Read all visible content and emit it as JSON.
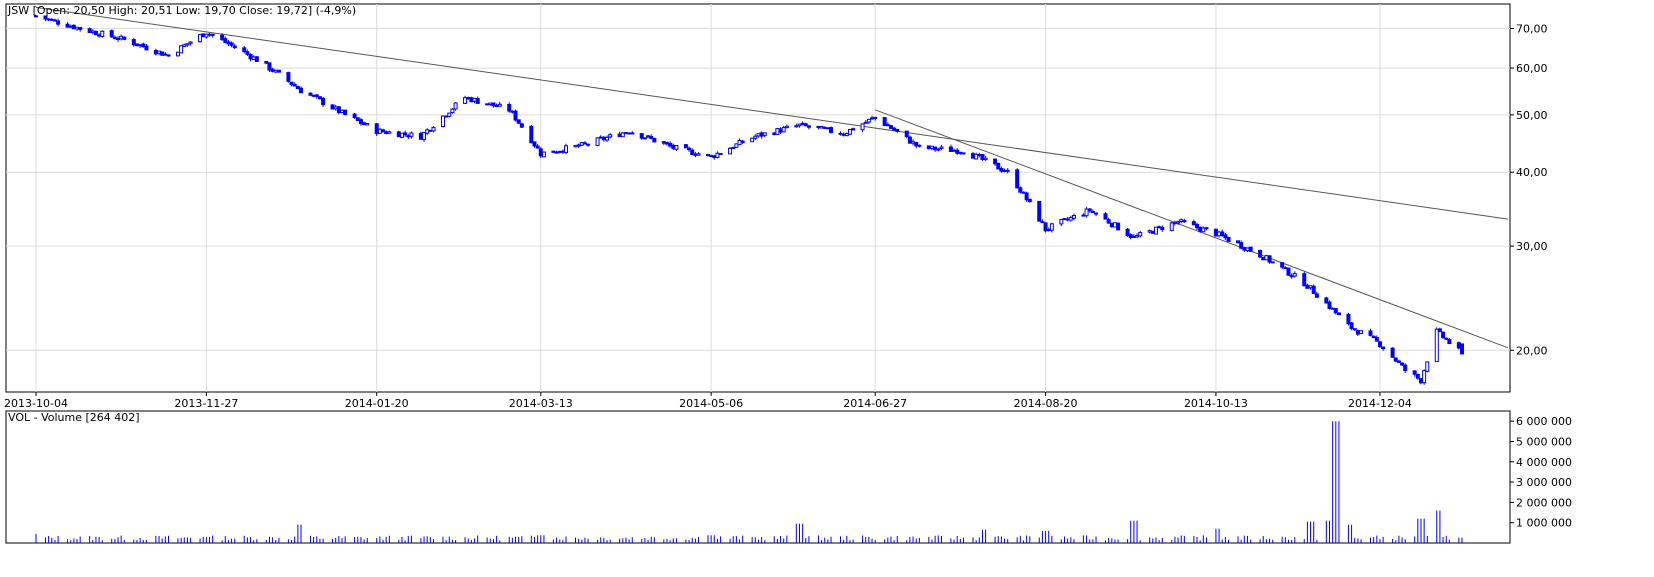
{
  "price_panel": {
    "header": "JSW [Open: 20,50  High: 20,51  Low: 19,70  Close: 19,72] (-4,9%)"
  },
  "volume_panel": {
    "header": "VOL - Volume [264 402]"
  },
  "colors": {
    "candle": "#0000ff",
    "trendline": "#555555",
    "grid": "#dcdcdc",
    "axis": "#000000",
    "background": "#ffffff"
  },
  "chart_data": [
    {
      "type": "candlestick",
      "symbol": "JSW",
      "y_scale": "log",
      "ylim": [
        17,
        77
      ],
      "yticks": [
        20,
        30,
        40,
        50,
        60,
        70
      ],
      "ytick_labels": [
        "20,00",
        "30,00",
        "40,00",
        "50,00",
        "60,00",
        "70,00"
      ],
      "x_tick_labels": [
        "2013-10-04",
        "2013-11-27",
        "2014-01-20",
        "2014-03-13",
        "2014-05-06",
        "2014-06-27",
        "2014-08-20",
        "2014-10-13",
        "2014-12-04"
      ],
      "grid": true,
      "last_bar": {
        "open": 20.5,
        "high": 20.51,
        "low": 19.7,
        "close": 19.72,
        "change_pct": -4.9
      },
      "series": [
        {
          "x": [
            "2013-10-04",
            "2013-10-18",
            "2013-11-01",
            "2013-11-15",
            "2013-11-27",
            "2013-12-13",
            "2013-12-27",
            "2014-01-10",
            "2014-01-20",
            "2014-02-03",
            "2014-02-17",
            "2014-03-03",
            "2014-03-13",
            "2014-03-27",
            "2014-04-10",
            "2014-04-24",
            "2014-05-06",
            "2014-05-20",
            "2014-06-03",
            "2014-06-17",
            "2014-06-27",
            "2014-07-11",
            "2014-07-25",
            "2014-08-08",
            "2014-08-20",
            "2014-09-03",
            "2014-09-17",
            "2014-10-01",
            "2014-10-13",
            "2014-10-27",
            "2014-11-10",
            "2014-11-24",
            "2014-12-04",
            "2014-12-12",
            "2014-12-17",
            "2014-12-22",
            "2014-12-30"
          ],
          "close": [
            73.5,
            70,
            67,
            63,
            69,
            62,
            55,
            50,
            47,
            46,
            53.5,
            51,
            43,
            44.5,
            47,
            44,
            42.5,
            46,
            48,
            46.5,
            49.5,
            44,
            43.5,
            40,
            32,
            34.5,
            31,
            33,
            31.5,
            29,
            26,
            22,
            20.5,
            18.5,
            17.8,
            21.5,
            19.72
          ]
        }
      ],
      "trendlines": [
        {
          "from": {
            "x": "2013-10-04",
            "y": 76
          },
          "to": {
            "x": "2014-12-30",
            "y": 34.2
          }
        },
        {
          "from": {
            "x": "2014-06-27",
            "y": 51
          },
          "to": {
            "x": "2014-12-30",
            "y": 21.6
          }
        }
      ]
    },
    {
      "type": "bar",
      "title": "VOL - Volume [264 402]",
      "ylim": [
        0,
        6500000
      ],
      "yticks": [
        1000000,
        2000000,
        3000000,
        4000000,
        5000000,
        6000000
      ],
      "ytick_labels": [
        "1 000 000",
        "2 000 000",
        "3 000 000",
        "4 000 000",
        "5 000 000",
        "6 000 000"
      ],
      "grid": false,
      "baseline": 250000,
      "spikes": [
        {
          "x": "2013-10-04",
          "value": 450000
        },
        {
          "x": "2013-11-27",
          "value": 300000
        },
        {
          "x": "2013-12-27",
          "value": 900000
        },
        {
          "x": "2014-03-13",
          "value": 380000
        },
        {
          "x": "2014-05-06",
          "value": 380000
        },
        {
          "x": "2014-06-03",
          "value": 950000
        },
        {
          "x": "2014-08-01",
          "value": 650000
        },
        {
          "x": "2014-08-20",
          "value": 600000
        },
        {
          "x": "2014-09-17",
          "value": 1100000
        },
        {
          "x": "2014-10-13",
          "value": 700000
        },
        {
          "x": "2014-11-12",
          "value": 1050000
        },
        {
          "x": "2014-11-17",
          "value": 1100000
        },
        {
          "x": "2014-11-20",
          "value": 6000000
        },
        {
          "x": "2014-11-24",
          "value": 900000
        },
        {
          "x": "2014-12-17",
          "value": 1200000
        },
        {
          "x": "2014-12-22",
          "value": 1600000
        },
        {
          "x": "2014-12-30",
          "value": 264402
        }
      ]
    }
  ]
}
